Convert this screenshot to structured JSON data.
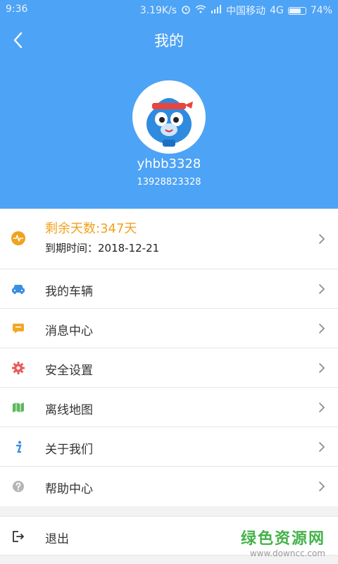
{
  "status_bar": {
    "time": "9:36",
    "speed": "3.19K/s",
    "carrier": "中国移动",
    "network": "4G",
    "battery": "74%",
    "battery_level": 0.74
  },
  "header": {
    "title": "我的",
    "username": "yhbb3328",
    "phone": "13928823328",
    "back_icon": "chevron-left-icon"
  },
  "subscription": {
    "days_left": "剩余天数:347天",
    "expire": "到期时间：2018-12-21",
    "icon": "pulse-icon",
    "color": "#f0a21f"
  },
  "menu": [
    {
      "label": "我的车辆",
      "icon": "car-icon",
      "color": "#3b8fe0"
    },
    {
      "label": "消息中心",
      "icon": "message-icon",
      "color": "#f5a623"
    },
    {
      "label": "安全设置",
      "icon": "gear-icon",
      "color": "#e85c5c"
    },
    {
      "label": "离线地图",
      "icon": "map-icon",
      "color": "#5cb85c"
    },
    {
      "label": "关于我们",
      "icon": "info-icon",
      "color": "#3b8fe0"
    },
    {
      "label": "帮助中心",
      "icon": "help-icon",
      "color": "#b5b5b5"
    }
  ],
  "logout": {
    "label": "退出",
    "icon": "logout-icon"
  },
  "watermark": {
    "brand": "绿色资源网",
    "url": "www.downcc.com"
  },
  "colors": {
    "header_bg": "#4da3f5",
    "accent_orange": "#f0a21f"
  }
}
